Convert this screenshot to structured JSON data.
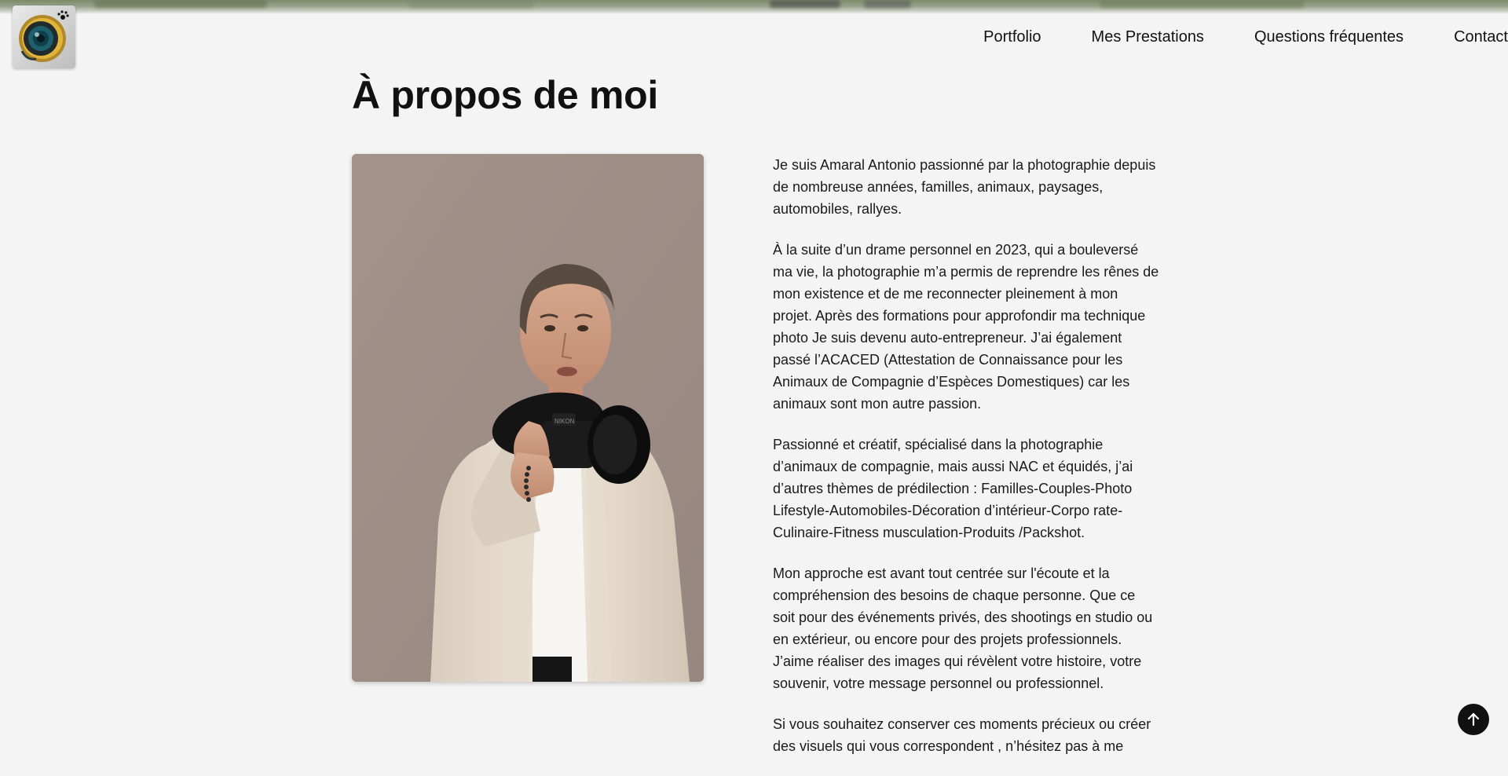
{
  "header": {
    "logo_icon": "camera-lens-paw-logo",
    "nav": [
      {
        "label": "Portfolio"
      },
      {
        "label": "Mes Prestations"
      },
      {
        "label": "Questions fréquentes"
      },
      {
        "label": "Contact"
      }
    ]
  },
  "main": {
    "title": "À propos de moi",
    "photo_icon": "photographer-portrait",
    "paragraphs": [
      "Je suis Amaral Antonio passionné par la photographie depuis de nombreuse années, familles, animaux, paysages, automobiles, rallyes.",
      "À la suite d’un drame personnel en 2023, qui a bouleversé ma vie, la photographie m’a permis de reprendre les rênes de mon existence et de me reconnecter pleinement à mon projet. Après des formations pour approfondir ma technique photo Je suis devenu auto-entrepreneur. J’ai également passé l’ACACED (Attestation de Connaissance pour les Animaux de Compagnie d’Espèces Domestiques) car les animaux sont mon autre passion.",
      "Passionné et créatif, spécialisé dans la photographie d’animaux de compagnie, mais aussi NAC et équidés, j’ai d’autres thèmes de prédilection : Familles-Couples-Photo Lifestyle-Automobiles-Décoration d’intérieur-Corpo rate-Culinaire-Fitness musculation-Produits /Packshot.",
      "Mon approche est avant tout centrée sur l'écoute et la compréhension des besoins de chaque personne. Que ce soit pour des événements privés, des shootings en studio ou en extérieur, ou encore pour des projets professionnels. J’aime réaliser des images qui révèlent votre histoire, votre souvenir, votre message personnel ou professionnel.",
      "Si vous souhaitez conserver ces moments précieux ou créer des visuels qui vous correspondent , n’hésitez pas à me"
    ]
  },
  "back_to_top": {
    "icon": "arrow-up-icon"
  },
  "colors": {
    "background": "#f4f4f4",
    "text": "#111111",
    "button": "#111111"
  }
}
